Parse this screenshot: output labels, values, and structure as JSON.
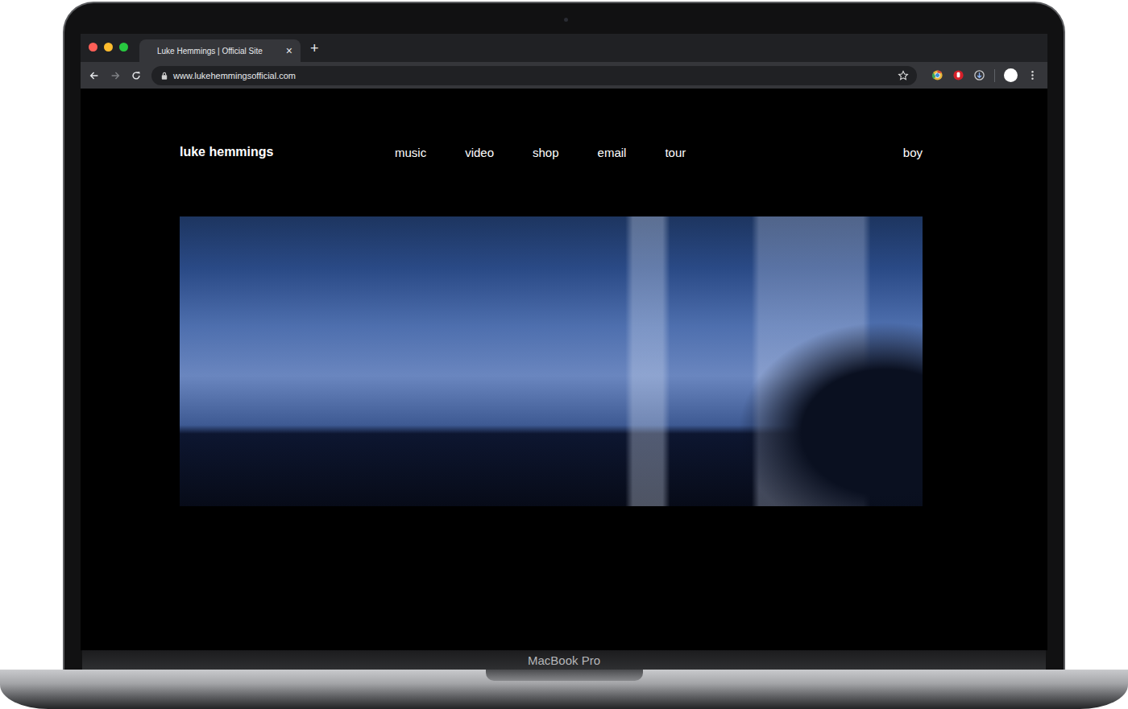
{
  "window": {
    "title": "Luke Hemmings | Official Site"
  },
  "window_controls": [
    {
      "name": "close",
      "color": "#ff5f57"
    },
    {
      "name": "minimize",
      "color": "#febc2e"
    },
    {
      "name": "zoom",
      "color": "#28c840"
    }
  ],
  "tabs": [
    {
      "label": "Luke Hemmings | Official Site",
      "selected": true,
      "close": "×"
    }
  ],
  "new_tab": "+",
  "toolbar": {
    "back_disabled": false,
    "forward_disabled": true,
    "url": "www.lukehemmingsofficial.com"
  },
  "page": {
    "brand": "luke hemmings",
    "nav": [
      {
        "label": "music"
      },
      {
        "label": "video"
      },
      {
        "label": "shop"
      },
      {
        "label": "email"
      },
      {
        "label": "tour"
      }
    ],
    "right_link": "boy"
  },
  "device": {
    "label": "MacBook Pro"
  }
}
